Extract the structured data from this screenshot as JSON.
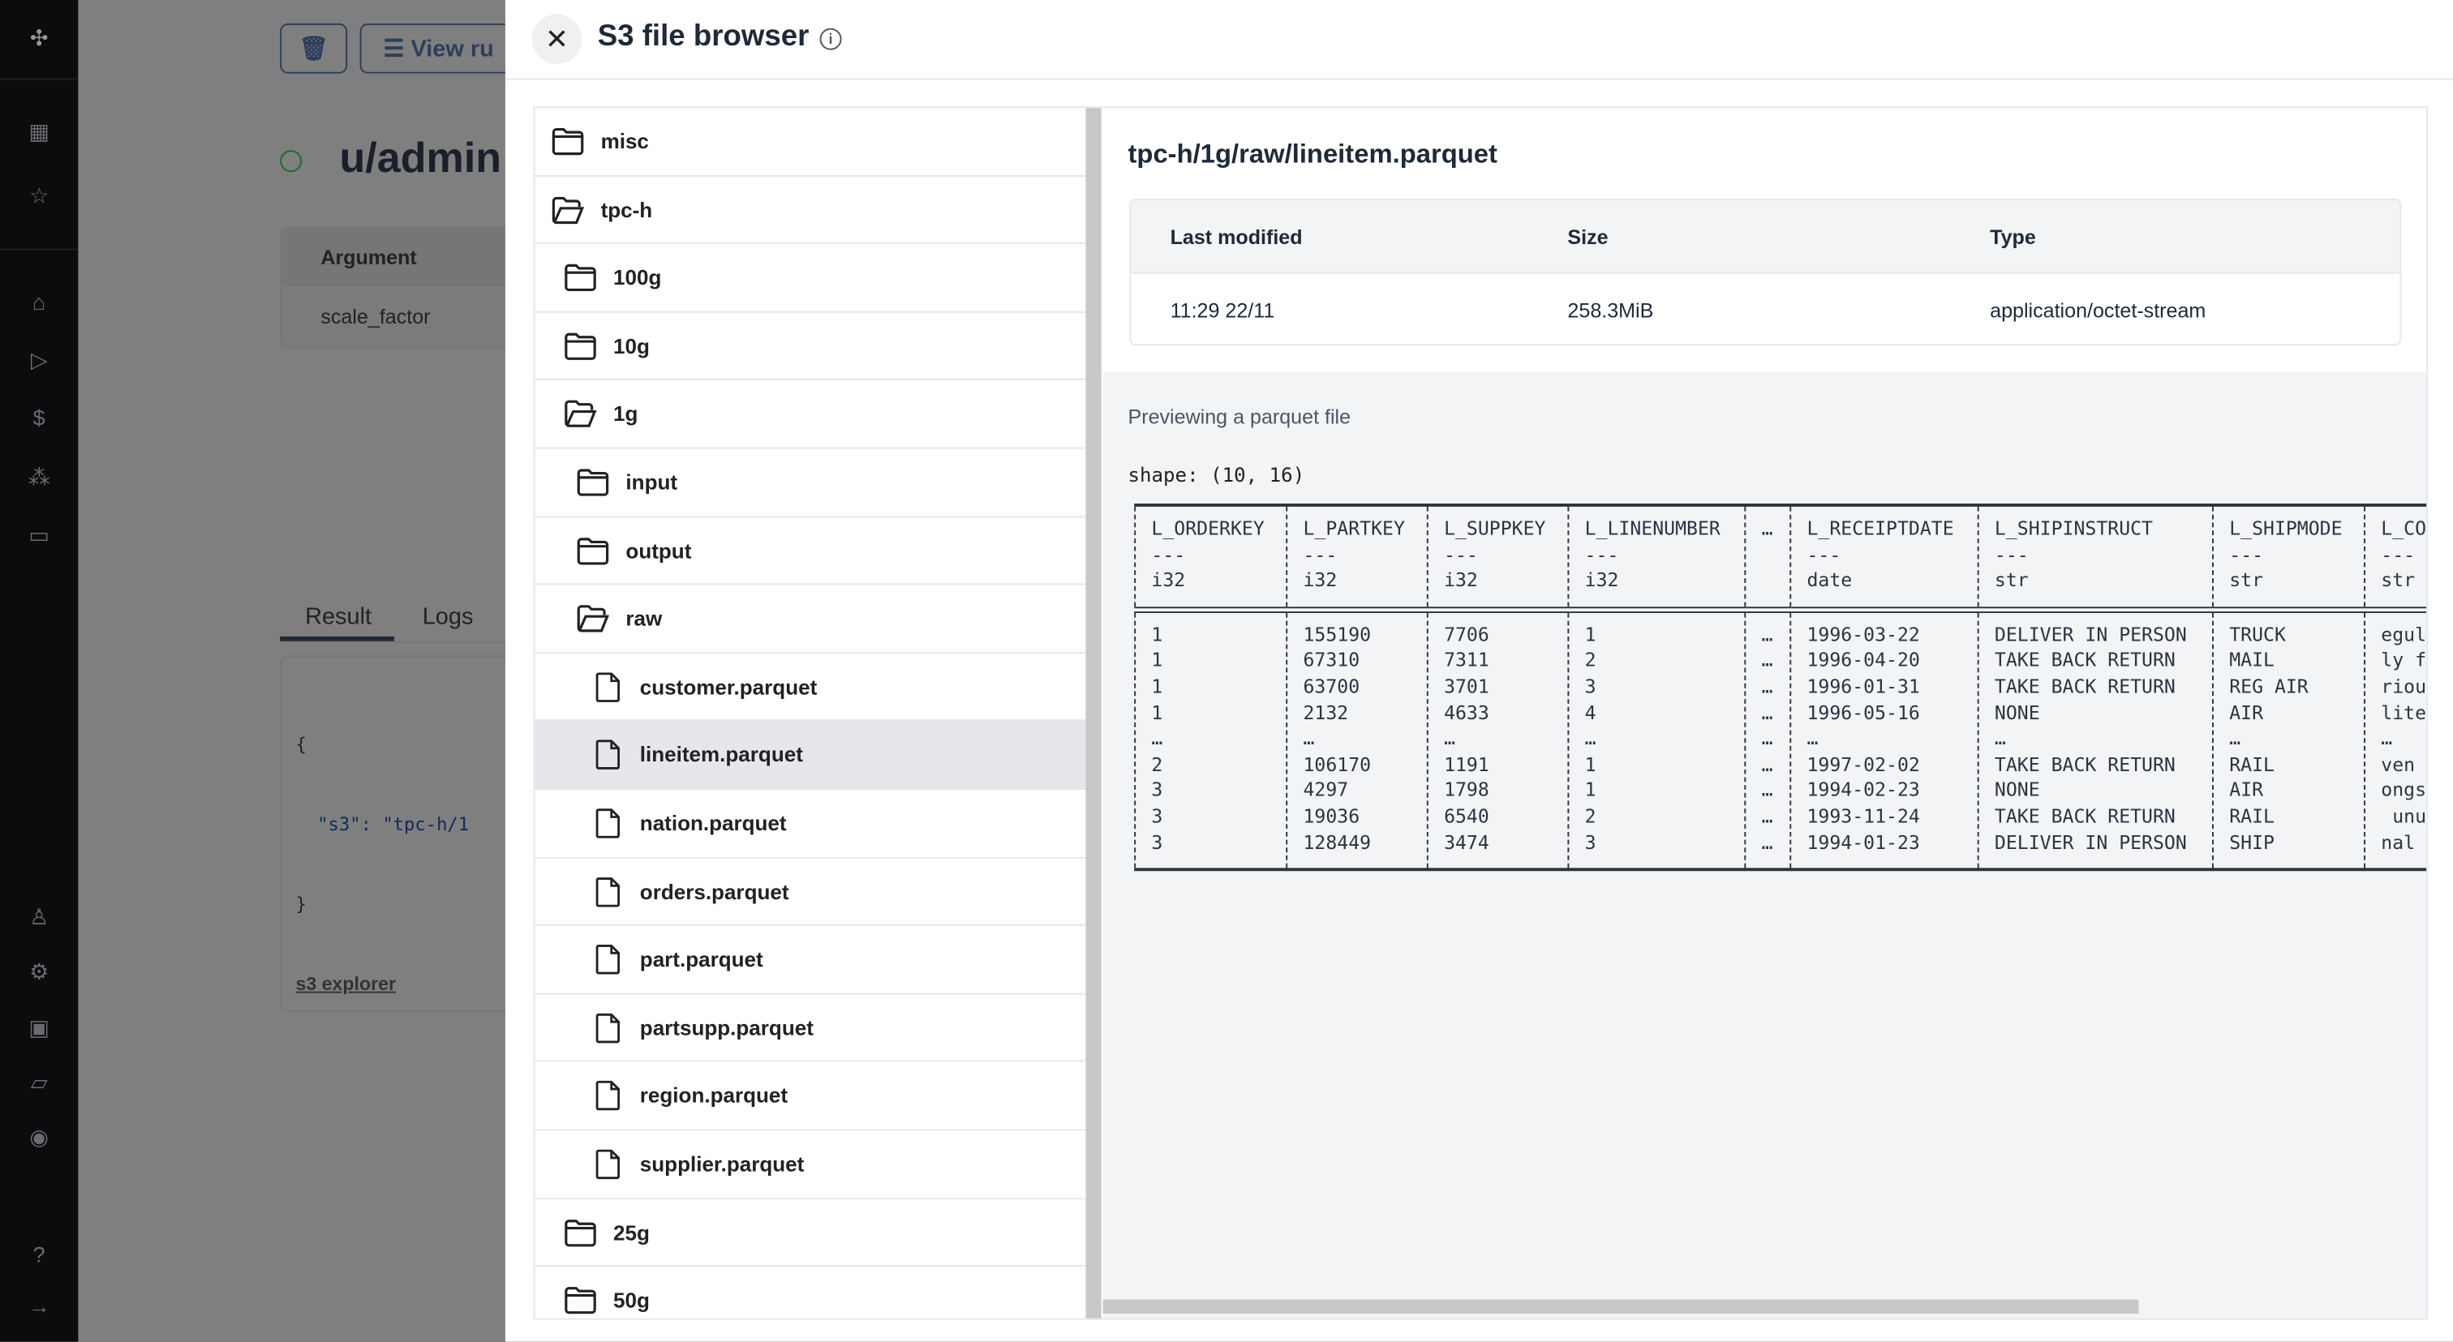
{
  "app": {
    "sidebar_icons": [
      "logo-icon",
      "building-icon",
      "star-icon",
      "home-icon",
      "play-icon",
      "dollar-icon",
      "cubes-icon",
      "calendar-icon",
      "user-icon",
      "gear-icon",
      "bot-icon",
      "folder-icon",
      "eye-icon",
      "help-icon",
      "expand-icon"
    ]
  },
  "background": {
    "view_runs_label": "View ru",
    "page_title": "u/admin",
    "args_header": "Argument",
    "arg_name": "scale_factor",
    "tabs": [
      "Result",
      "Logs"
    ],
    "result_lines": [
      "{",
      "  \"s3\": \"tpc-h/1",
      "}"
    ],
    "explorer_link": "s3 explorer"
  },
  "drawer": {
    "title": "S3 file browser",
    "tree": [
      {
        "label": "misc",
        "type": "folder",
        "level": 0
      },
      {
        "label": "tpc-h",
        "type": "folder-open",
        "level": 0
      },
      {
        "label": "100g",
        "type": "folder",
        "level": 1
      },
      {
        "label": "10g",
        "type": "folder",
        "level": 1
      },
      {
        "label": "1g",
        "type": "folder-open",
        "level": 1
      },
      {
        "label": "input",
        "type": "folder",
        "level": 2
      },
      {
        "label": "output",
        "type": "folder",
        "level": 2
      },
      {
        "label": "raw",
        "type": "folder-open",
        "level": 2
      },
      {
        "label": "customer.parquet",
        "type": "file",
        "level": 3
      },
      {
        "label": "lineitem.parquet",
        "type": "file",
        "level": 3,
        "selected": true
      },
      {
        "label": "nation.parquet",
        "type": "file",
        "level": 3
      },
      {
        "label": "orders.parquet",
        "type": "file",
        "level": 3
      },
      {
        "label": "part.parquet",
        "type": "file",
        "level": 3
      },
      {
        "label": "partsupp.parquet",
        "type": "file",
        "level": 3
      },
      {
        "label": "region.parquet",
        "type": "file",
        "level": 3
      },
      {
        "label": "supplier.parquet",
        "type": "file",
        "level": 3
      },
      {
        "label": "25g",
        "type": "folder",
        "level": 1
      },
      {
        "label": "50g",
        "type": "folder",
        "level": 1
      }
    ],
    "path": "tpc-h/1g/raw/lineitem.parquet",
    "meta": {
      "headers": [
        "Last modified",
        "Size",
        "Type"
      ],
      "values": [
        "11:29 22/11",
        "258.3MiB",
        "application/octet-stream"
      ]
    },
    "preview_label": "Previewing a parquet file",
    "shape": "shape: (10, 16)",
    "table": {
      "columns": [
        [
          "L_ORDERKEY",
          "---",
          "i32"
        ],
        [
          "L_PARTKEY",
          "---",
          "i32"
        ],
        [
          "L_SUPPKEY",
          "---",
          "i32"
        ],
        [
          "L_LINENUMBER",
          "---",
          "i32"
        ],
        [
          "…",
          "",
          ""
        ],
        [
          "L_RECEIPTDATE",
          "---",
          "date"
        ],
        [
          "L_SHIPINSTRUCT",
          "---",
          "str"
        ],
        [
          "L_SHIPMODE",
          "---",
          "str"
        ],
        [
          "L_CO",
          "---",
          "str"
        ]
      ],
      "rows": [
        [
          "1",
          "155190",
          "7706",
          "1",
          "…",
          "1996-03-22",
          "DELIVER IN PERSON",
          "TRUCK",
          "egul"
        ],
        [
          "1",
          "67310",
          "7311",
          "2",
          "…",
          "1996-04-20",
          "TAKE BACK RETURN",
          "MAIL",
          "ly f"
        ],
        [
          "1",
          "63700",
          "3701",
          "3",
          "…",
          "1996-01-31",
          "TAKE BACK RETURN",
          "REG AIR",
          "riou"
        ],
        [
          "1",
          "2132",
          "4633",
          "4",
          "…",
          "1996-05-16",
          "NONE",
          "AIR",
          "lite"
        ],
        [
          "…",
          "…",
          "…",
          "…",
          "…",
          "…",
          "…",
          "…",
          "…"
        ],
        [
          "2",
          "106170",
          "1191",
          "1",
          "…",
          "1997-02-02",
          "TAKE BACK RETURN",
          "RAIL",
          "ven "
        ],
        [
          "3",
          "4297",
          "1798",
          "1",
          "…",
          "1994-02-23",
          "NONE",
          "AIR",
          "ongs"
        ],
        [
          "3",
          "19036",
          "6540",
          "2",
          "…",
          "1993-11-24",
          "TAKE BACK RETURN",
          "RAIL",
          " unu"
        ],
        [
          "3",
          "128449",
          "3474",
          "3",
          "…",
          "1994-01-23",
          "DELIVER IN PERSON",
          "SHIP",
          "nal "
        ]
      ]
    }
  }
}
